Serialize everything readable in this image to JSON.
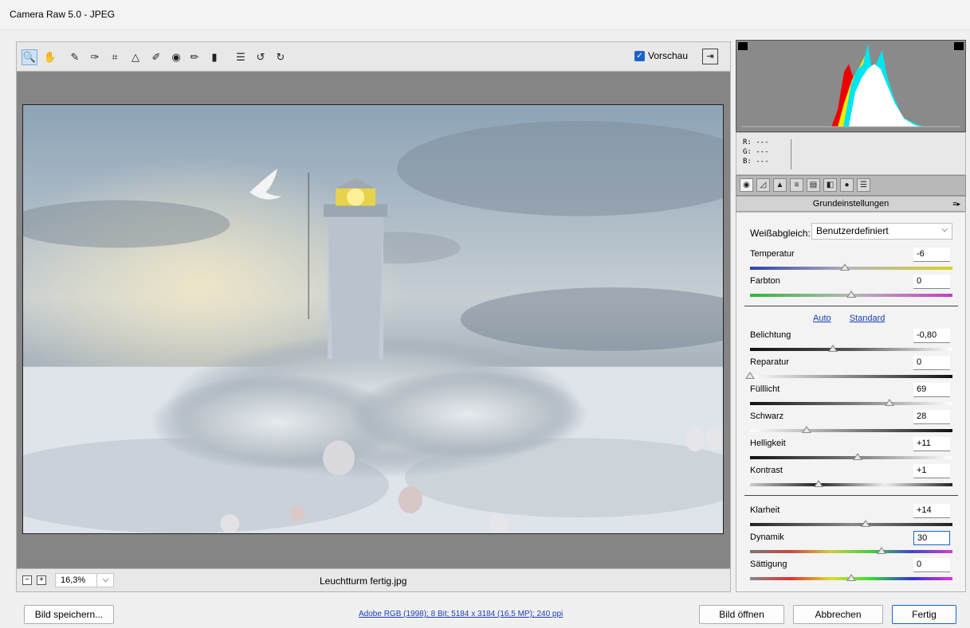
{
  "window": {
    "title": "Camera Raw 5.0 - JPEG"
  },
  "toolbar": {
    "tools": [
      {
        "name": "zoom-tool-icon",
        "glyph": "🔍",
        "active": true
      },
      {
        "name": "hand-tool-icon",
        "glyph": "✋",
        "active": false
      },
      {
        "name": "white-balance-tool-icon",
        "glyph": "✎",
        "active": false
      },
      {
        "name": "color-sampler-tool-icon",
        "glyph": "✑",
        "active": false
      },
      {
        "name": "crop-tool-icon",
        "glyph": "⌗",
        "active": false
      },
      {
        "name": "straighten-tool-icon",
        "glyph": "△",
        "active": false
      },
      {
        "name": "spot-removal-tool-icon",
        "glyph": "✐",
        "active": false
      },
      {
        "name": "red-eye-tool-icon",
        "glyph": "◉",
        "active": false
      },
      {
        "name": "adjustment-brush-icon",
        "glyph": "✏",
        "active": false
      },
      {
        "name": "graduated-filter-icon",
        "glyph": "▮",
        "active": false
      },
      {
        "name": "preferences-icon",
        "glyph": "☰",
        "active": false
      },
      {
        "name": "rotate-left-icon",
        "glyph": "↺",
        "active": false
      },
      {
        "name": "rotate-right-icon",
        "glyph": "↻",
        "active": false
      }
    ],
    "preview_label": "Vorschau",
    "preview_checked": true
  },
  "statusbar": {
    "zoom": "16,3%",
    "filename": "Leuchtturm fertig.jpg"
  },
  "rgb_readout": {
    "r": "R: ---",
    "g": "G: ---",
    "b": "B: ---"
  },
  "panel": {
    "section_title": "Grundeinstellungen",
    "wb_label": "Weißabgleich:",
    "wb_value": "Benutzerdefiniert",
    "auto_label": "Auto",
    "standard_label": "Standard",
    "sliders": [
      {
        "name": "temperatur",
        "label": "Temperatur",
        "value": "-6",
        "level": 0.47,
        "gradient": "linear-gradient(to right, #2d3fb3, #b8b8b8, #d8d12a)"
      },
      {
        "name": "farbton",
        "label": "Farbton",
        "value": "0",
        "level": 0.5,
        "gradient": "linear-gradient(to right, #31b53a, #b8b8b8, #c43dc4)"
      },
      {
        "name": "belichtung",
        "label": "Belichtung",
        "value": "-0,80",
        "level": 0.41,
        "gradient": "linear-gradient(to right, #111, #555, #fff)"
      },
      {
        "name": "reparatur",
        "label": "Reparatur",
        "value": "0",
        "level": 0.0,
        "gradient": "linear-gradient(to right, #fff, #888, #111)"
      },
      {
        "name": "fuelllicht",
        "label": "Fülllicht",
        "value": "69",
        "level": 0.69,
        "gradient": "linear-gradient(to right, #111, #777, #fff)"
      },
      {
        "name": "schwarz",
        "label": "Schwarz",
        "value": "28",
        "level": 0.28,
        "gradient": "linear-gradient(to right, #fff, #888, #111)"
      },
      {
        "name": "helligkeit",
        "label": "Helligkeit",
        "value": "+11",
        "level": 0.53,
        "gradient": "linear-gradient(to right, #111, #777, #fff)"
      },
      {
        "name": "kontrast",
        "label": "Kontrast",
        "value": "+1",
        "level": 0.34,
        "gradient": "linear-gradient(to right, #ccc, #222, #eee, #222)"
      },
      {
        "name": "klarheit",
        "label": "Klarheit",
        "value": "+14",
        "level": 0.57,
        "gradient": "linear-gradient(to right, #222, #888, #222)"
      },
      {
        "name": "dynamik",
        "label": "Dynamik",
        "value": "30",
        "level": 0.65,
        "gradient": "linear-gradient(to right, #777, #c44, #cc4, #4c4, #44c, #c4c)",
        "focused": true
      },
      {
        "name": "saettigung",
        "label": "Sättigung",
        "value": "0",
        "level": 0.5,
        "gradient": "linear-gradient(to right, #888, #d33, #dd3, #3d3, #33d, #d3d)"
      }
    ]
  },
  "footer": {
    "save_label": "Bild speichern...",
    "info": "Adobe RGB (1998); 8 Bit; 5184 x 3184 (16,5 MP); 240 ppi",
    "open_label": "Bild öffnen",
    "cancel_label": "Abbrechen",
    "done_label": "Fertig"
  }
}
